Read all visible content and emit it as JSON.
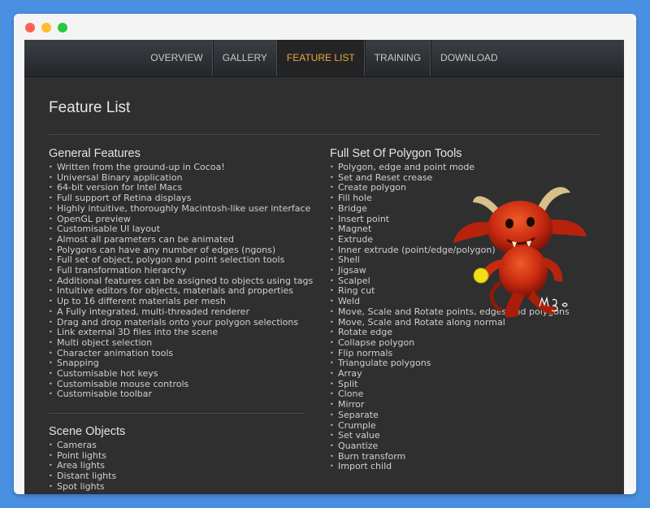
{
  "nav": {
    "items": [
      "OVERVIEW",
      "GALLERY",
      "FEATURE LIST",
      "TRAINING",
      "DOWNLOAD"
    ],
    "active": "FEATURE LIST",
    "active_color": "#f0a73a"
  },
  "page_title": "Feature List",
  "general": {
    "title": "General Features",
    "items": [
      "Written from the ground-up in Cocoa!",
      "Universal Binary application",
      "64-bit version for Intel Macs",
      "Full support of Retina displays",
      "Highly intuitive, thoroughly Macintosh-like user interface",
      "OpenGL preview",
      "Customisable UI layout",
      "Almost all parameters can be animated",
      "Polygons can have any number of edges (ngons)",
      "Full set of object, polygon and point selection tools",
      "Full transformation hierarchy",
      "Additional features can be assigned to objects using tags",
      "Intuitive editors for objects, materials and properties",
      "Up to 16 different materials per mesh",
      "A Fully integrated, multi-threaded renderer",
      "Drag and drop materials onto your polygon selections",
      "Link external 3D files into the scene",
      "Multi object selection",
      "Character animation tools",
      "Snapping",
      "Customisable hot keys",
      "Customisable mouse controls",
      "Customisable toolbar"
    ]
  },
  "scene": {
    "title": "Scene Objects",
    "items": [
      "Cameras",
      "Point lights",
      "Area lights",
      "Distant lights",
      "Spot lights"
    ]
  },
  "polygon": {
    "title": "Full Set Of Polygon Tools",
    "items": [
      "Polygon, edge and point mode",
      "Set and Reset crease",
      "Create polygon",
      "Fill hole",
      "Bridge",
      "Insert point",
      "Magnet",
      "Extrude",
      "Inner extrude (point/edge/polygon)",
      "Shell",
      "Jigsaw",
      "Scalpel",
      "Ring cut",
      "Weld",
      "Move, Scale and Rotate points, edges and polygons",
      "Move, Scale and Rotate along normal",
      "Rotate edge",
      "Collapse polygon",
      "Flip normals",
      "Triangulate polygons",
      "Array",
      "Split",
      "Clone",
      "Mirror",
      "Separate",
      "Crumple",
      "Set value",
      "Quantize",
      "Burn transform",
      "Import child"
    ]
  },
  "mascot_signature": "M.Bo 12"
}
